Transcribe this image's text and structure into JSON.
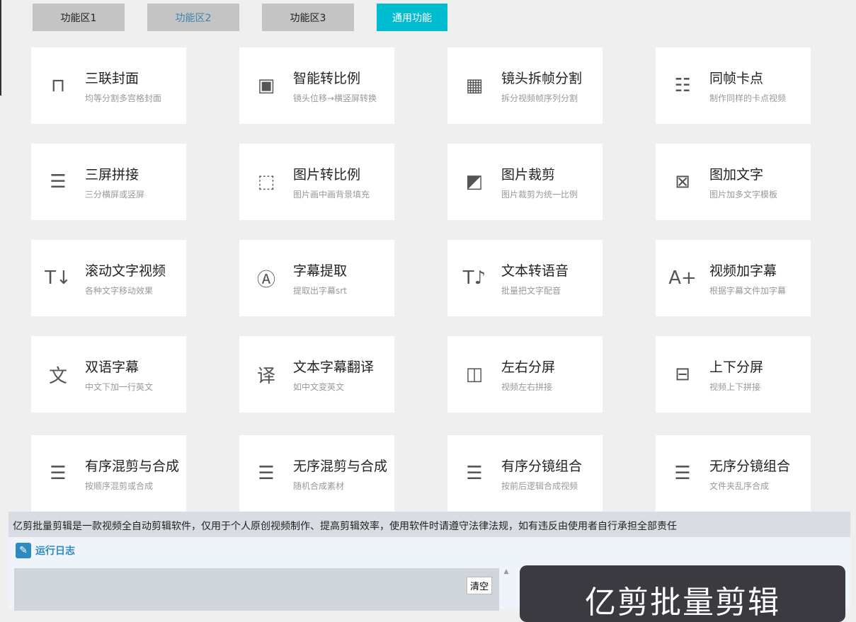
{
  "tabs": [
    {
      "label": "功能区1"
    },
    {
      "label": "功能区2"
    },
    {
      "label": "功能区3"
    },
    {
      "label": "通用功能"
    }
  ],
  "cards": [
    {
      "title": "三联封面",
      "sub": "均等分割多宫格封面",
      "icon": "triple-cover-icon"
    },
    {
      "title": "智能转比例",
      "sub": "镜头位移→横竖屏转换",
      "icon": "smart-ratio-icon"
    },
    {
      "title": "镜头拆帧分割",
      "sub": "拆分视频帧序列分割",
      "icon": "film-split-icon"
    },
    {
      "title": "同帧卡点",
      "sub": "制作同样的卡点视频",
      "icon": "frame-beat-icon"
    },
    {
      "title": "三屏拼接",
      "sub": "三分横屏或竖屏",
      "icon": "three-screen-icon"
    },
    {
      "title": "图片转比例",
      "sub": "图片画中画背景填充",
      "icon": "image-ratio-icon"
    },
    {
      "title": "图片裁剪",
      "sub": "图片裁剪为统一比例",
      "icon": "image-crop-icon"
    },
    {
      "title": "图加文字",
      "sub": "图片加多文字模板",
      "icon": "image-text-icon"
    },
    {
      "title": "滚动文字视频",
      "sub": "各种文字移动效果",
      "icon": "scroll-text-icon"
    },
    {
      "title": "字幕提取",
      "sub": "提取出字幕srt",
      "icon": "subtitle-extract-icon"
    },
    {
      "title": "文本转语音",
      "sub": "批量把文字配音",
      "icon": "text-to-speech-icon"
    },
    {
      "title": "视频加字幕",
      "sub": "根据字幕文件加字幕",
      "icon": "add-subtitle-icon"
    },
    {
      "title": "双语字幕",
      "sub": "中文下加一行英文",
      "icon": "bilingual-icon"
    },
    {
      "title": "文本字幕翻译",
      "sub": "如中文变英文",
      "icon": "translate-icon"
    },
    {
      "title": "左右分屏",
      "sub": "视频左右拼接",
      "icon": "split-lr-icon"
    },
    {
      "title": "上下分屏",
      "sub": "视频上下拼接",
      "icon": "split-tb-icon"
    },
    {
      "title": "有序混剪与合成",
      "sub": "按顺序混剪或合成",
      "icon": "ordered-list-icon"
    },
    {
      "title": "无序混剪与合成",
      "sub": "随机合成素材",
      "icon": "unordered-list-icon"
    },
    {
      "title": "有序分镜组合",
      "sub": "按前后逻辑合成视频",
      "icon": "ordered-list-icon"
    },
    {
      "title": "无序分镜组合",
      "sub": "文件夹乱序合成",
      "icon": "unordered-list-icon"
    }
  ],
  "notice": "亿剪批量剪辑是一款视频全自动剪辑软件，仅用于个人原创视频制作、提高剪辑效率，使用软件时请遵守法律法规，如有违反由使用者自行承担全部责任",
  "log": {
    "title": "运行日志",
    "clear": "清空"
  },
  "banner": "亿剪批量剪辑"
}
